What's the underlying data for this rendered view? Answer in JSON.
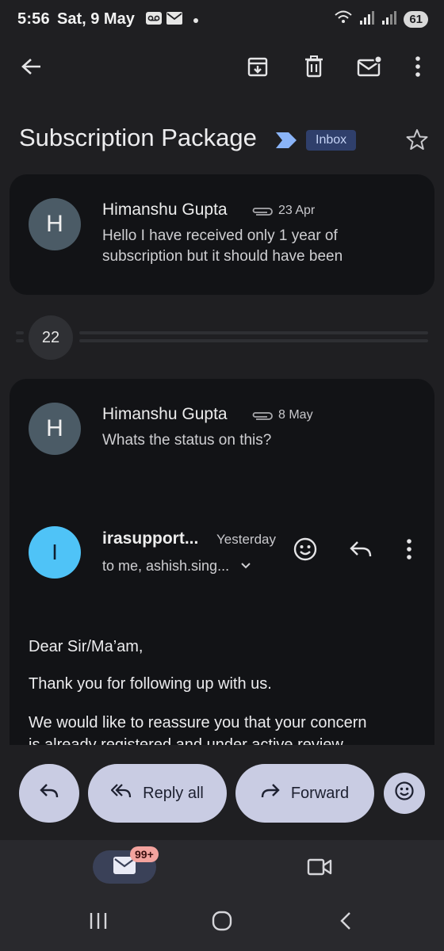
{
  "status_bar": {
    "time": "5:56",
    "date": "Sat, 9 May",
    "battery": "61",
    "icons": [
      "voicemail-icon",
      "mail-icon",
      "wifi-icon",
      "signal-icon",
      "signal-icon"
    ]
  },
  "toolbar": {
    "back_icon": "arrow-left-icon",
    "actions": [
      "archive-icon",
      "delete-icon",
      "mark-unread-icon",
      "more-vert-icon"
    ]
  },
  "thread": {
    "subject": "Subscription Package",
    "label_chip": "Inbox",
    "collapsed_count": "22"
  },
  "messages": [
    {
      "avatar_letter": "H",
      "sender": "Himanshu Gupta",
      "date": "23 Apr",
      "has_attachment": true,
      "snippet_line1": "Hello I have received only 1 year of",
      "snippet_line2": "subscription but it should have been"
    },
    {
      "avatar_letter": "H",
      "sender": "Himanshu Gupta",
      "date": "8 May",
      "has_attachment": true,
      "snippet_line1": "Whats the status on this?"
    }
  ],
  "expanded_message": {
    "avatar_letter": "I",
    "sender": "irasupport...",
    "date": "Yesterday",
    "recipients": "to me, ashish.sing...",
    "body": {
      "greeting": "Dear Sir/Ma’am,",
      "p1": "Thank you for following up with us.",
      "p2_line1": "We would like to reassure you that your concern",
      "p2_line2": "is already registered and under active review"
    }
  },
  "actions": {
    "reply_all": "Reply all",
    "forward": "Forward"
  },
  "bottom_nav": {
    "mail_badge": "99+"
  },
  "colors": {
    "background": "#1f1f22",
    "card": "#121316",
    "pill": "#c9cce3",
    "chip": "#2f3f6b",
    "avatar_h": "#4b5b66",
    "avatar_i": "#4fc3f7",
    "badge": "#f3a39e"
  }
}
